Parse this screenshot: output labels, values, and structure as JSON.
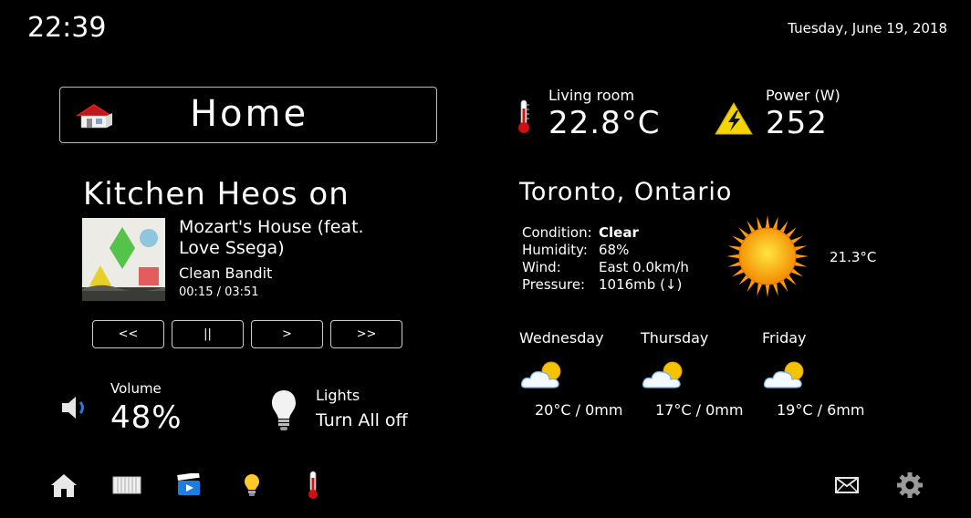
{
  "header": {
    "clock": "22:39",
    "date": "Tuesday, June 19, 2018"
  },
  "room": {
    "name": "Home",
    "icon": "house-icon"
  },
  "player": {
    "title": "Kitchen Heos on",
    "track": "Mozart's House (feat. Love Ssega)",
    "artist": "Clean Bandit",
    "time": "00:15 / 03:51",
    "controls": {
      "prev": "<<",
      "pause": "||",
      "play": ">",
      "next": ">>"
    }
  },
  "volume": {
    "label": "Volume",
    "value": "48%",
    "icon": "speaker-icon"
  },
  "lights": {
    "label": "Lights",
    "value": "Turn All off",
    "icon": "lightbulb-icon"
  },
  "sensors": {
    "living": {
      "label": "Living room",
      "value": "22.8°C",
      "icon": "thermometer-icon"
    },
    "power": {
      "label": "Power (W)",
      "value": "252",
      "icon": "high-voltage-icon"
    }
  },
  "weather": {
    "city": "Toronto, Ontario",
    "rows": [
      {
        "key": "Condition:",
        "value": "Clear"
      },
      {
        "key": "Humidity:",
        "value": "68%"
      },
      {
        "key": "Wind:",
        "value": "East 0.0km/h"
      },
      {
        "key": "Pressure:",
        "value": "1016mb (↓)"
      }
    ],
    "current_temp": "21.3°C",
    "icon": "sun-icon",
    "forecast": [
      {
        "day": "Wednesday",
        "value": "20°C / 0mm",
        "icon": "partly-cloudy-icon"
      },
      {
        "day": "Thursday",
        "value": "17°C / 0mm",
        "icon": "partly-cloudy-icon"
      },
      {
        "day": "Friday",
        "value": "19°C / 6mm",
        "icon": "partly-cloudy-icon"
      }
    ]
  },
  "nav": {
    "items": [
      "home-icon",
      "radiator-icon",
      "video-icon",
      "lightbulb-icon",
      "thermometer-icon"
    ],
    "right": [
      "mail-icon",
      "settings-gear-icon"
    ]
  },
  "colors": {
    "background": "#000000",
    "text": "#ffffff",
    "accent_blue": "#1e7de0",
    "house_red": "#e02020",
    "warning_yellow": "#f5d400"
  }
}
